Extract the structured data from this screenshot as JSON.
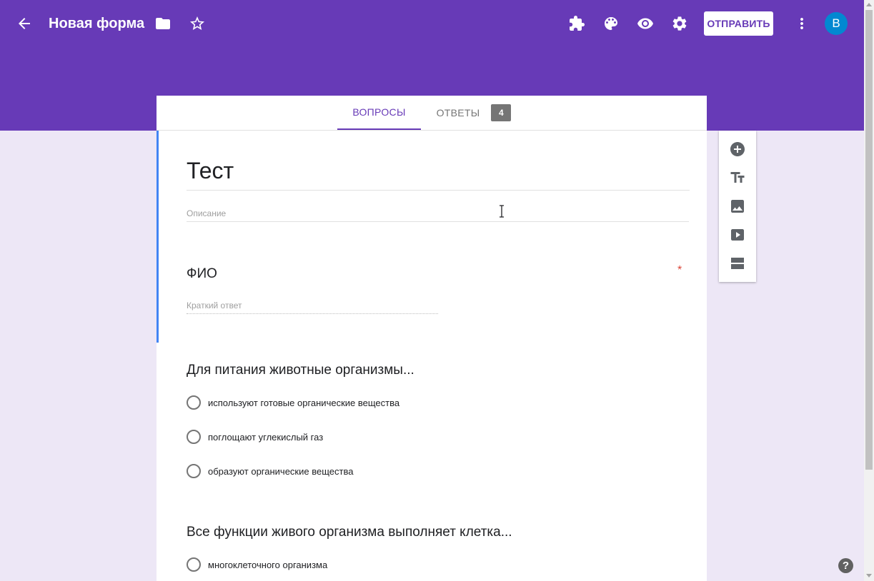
{
  "header": {
    "form_title": "Новая форма",
    "send_label": "ОТПРАВИТЬ",
    "avatar_initial": "В",
    "icons": [
      "back-arrow-icon",
      "folder-icon",
      "star-icon",
      "addon-puzzle-icon",
      "palette-icon",
      "eye-preview-icon",
      "gear-icon",
      "more-vert-icon"
    ],
    "color": "#673ab7"
  },
  "tabs": {
    "questions_label": "ВОПРОСЫ",
    "answers_label": "ОТВЕТЫ",
    "answers_count": "4"
  },
  "form": {
    "title": "Тест",
    "description_placeholder": "Описание",
    "questions": [
      {
        "title": "ФИО",
        "required_mark": "*",
        "answer_placeholder": "Краткий ответ"
      },
      {
        "title": "Для питания животные организмы...",
        "options": [
          "используют готовые органические вещества",
          "поглощают углекислый газ",
          "образуют органические вещества"
        ]
      },
      {
        "title": "Все функции живого организма выполняет клетка...",
        "options": [
          "многоклеточного организма"
        ]
      }
    ]
  },
  "sidebar": {
    "icons": [
      "add-circle-icon",
      "title-text-icon",
      "image-icon",
      "video-icon",
      "section-icon"
    ]
  },
  "help_label": "?",
  "colors": {
    "accent": "#673ab7",
    "background": "#ede7f6",
    "focus": "#4285f4",
    "required": "#db4437",
    "avatar": "#0288d1"
  }
}
